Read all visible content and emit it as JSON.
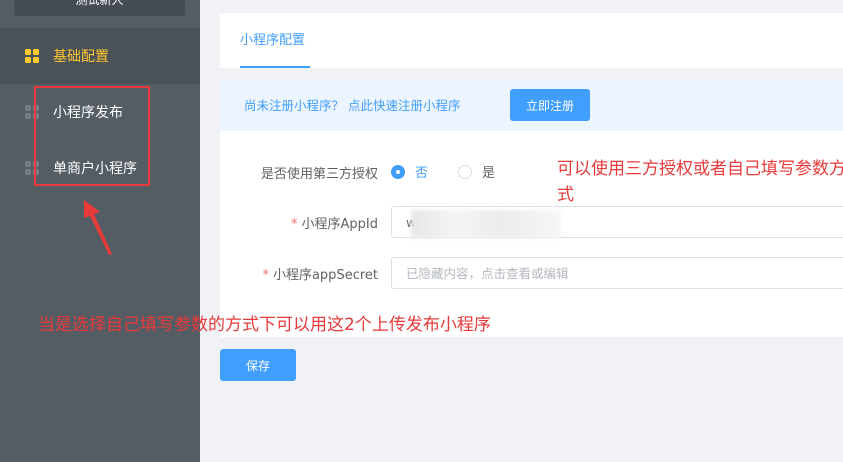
{
  "sidebar": {
    "top_button": "测试新人",
    "items": [
      {
        "label": "基础配置",
        "icon": "grid-icon",
        "active": true
      },
      {
        "label": "小程序发布",
        "icon": "grid-icon",
        "active": false
      },
      {
        "label": "单商户小程序",
        "icon": "grid-icon",
        "active": false
      }
    ]
  },
  "main": {
    "tabs": [
      {
        "label": "小程序配置"
      }
    ],
    "notice": {
      "text": "尚未注册小程序？ 点此快速注册小程序",
      "button_label": "立即注册"
    },
    "form": {
      "auth": {
        "label": "是否使用第三方授权",
        "options": [
          "否",
          "是"
        ],
        "selected": "否"
      },
      "appid": {
        "label": "小程序AppId",
        "required_mark": "*",
        "value": "wx"
      },
      "secret": {
        "label": "小程序appSecret",
        "required_mark": "*",
        "placeholder": "已隐藏内容，点击查看或编辑"
      }
    },
    "save_label": "保存"
  },
  "annotations": {
    "right_note": "可以使用三方授权或者自己填写参数方式",
    "bottom_note": "当是选择自己填写参数的方式下可以用这2个上传发布小程序"
  },
  "colors": {
    "sidebar_bg": "#545c64",
    "accent": "#409eff",
    "active_menu": "#ffc82c",
    "annotation": "#e83a3a"
  }
}
